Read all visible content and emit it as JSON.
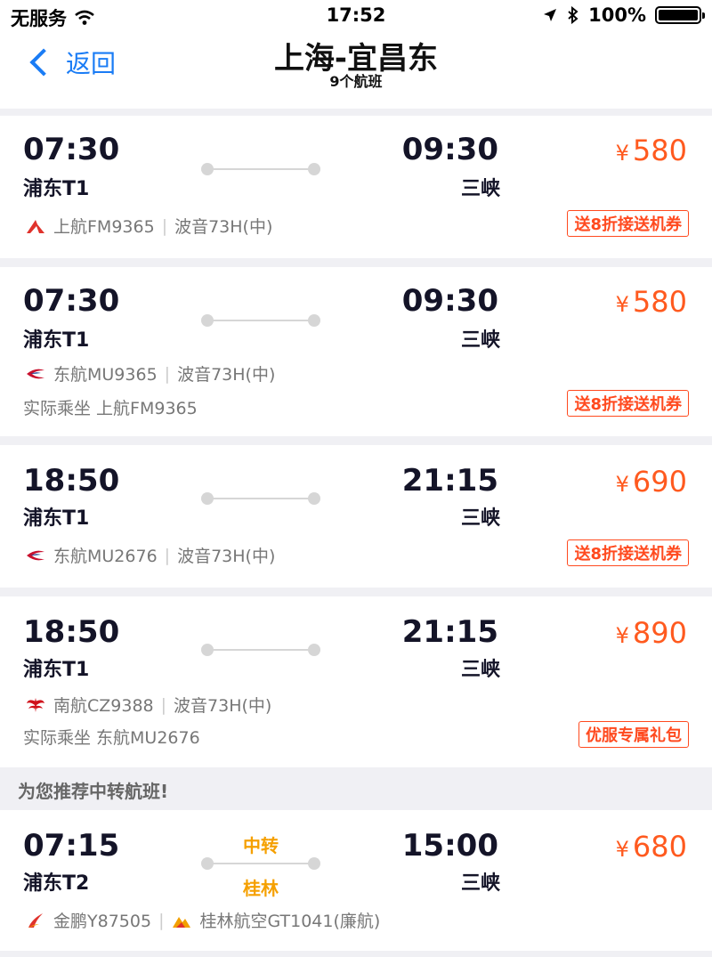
{
  "status_bar": {
    "carrier": "无服务",
    "time": "17:52",
    "battery": "100%"
  },
  "nav": {
    "back_label": "返回",
    "title": "上海-宜昌东",
    "subtitle": "9个航班"
  },
  "flights": [
    {
      "dep_time": "07:30",
      "dep_airport": "浦东T1",
      "arr_time": "09:30",
      "arr_airport": "三峡",
      "price": "580",
      "currency": "¥",
      "airline": "上航FM9365",
      "aircraft": "波音73H(中)",
      "actual": "",
      "promo": "送8折接送机券",
      "logo": "shanghai-airlines-logo"
    },
    {
      "dep_time": "07:30",
      "dep_airport": "浦东T1",
      "arr_time": "09:30",
      "arr_airport": "三峡",
      "price": "580",
      "currency": "¥",
      "airline": "东航MU9365",
      "aircraft": "波音73H(中)",
      "actual": "实际乘坐 上航FM9365",
      "promo": "送8折接送机券",
      "logo": "china-eastern-logo"
    },
    {
      "dep_time": "18:50",
      "dep_airport": "浦东T1",
      "arr_time": "21:15",
      "arr_airport": "三峡",
      "price": "690",
      "currency": "¥",
      "airline": "东航MU2676",
      "aircraft": "波音73H(中)",
      "actual": "",
      "promo": "送8折接送机券",
      "logo": "china-eastern-logo"
    },
    {
      "dep_time": "18:50",
      "dep_airport": "浦东T1",
      "arr_time": "21:15",
      "arr_airport": "三峡",
      "price": "890",
      "currency": "¥",
      "airline": "南航CZ9388",
      "aircraft": "波音73H(中)",
      "actual": "实际乘坐 东航MU2676",
      "promo": "优服专属礼包",
      "logo": "china-southern-logo"
    }
  ],
  "transfer_section": {
    "header": "为您推荐中转航班!",
    "flight": {
      "dep_time": "07:15",
      "dep_airport": "浦东T2",
      "arr_time": "15:00",
      "arr_airport": "三峡",
      "price": "680",
      "currency": "¥",
      "transfer_label": "中转",
      "transfer_city": "桂林",
      "airline1": "金鹏Y87505",
      "airline2": "桂林航空GT1041(廉航)"
    }
  },
  "colors": {
    "accent_blue": "#1a7cf5",
    "price_orange": "#ff5a1f",
    "transfer_orange": "#f5a000"
  }
}
